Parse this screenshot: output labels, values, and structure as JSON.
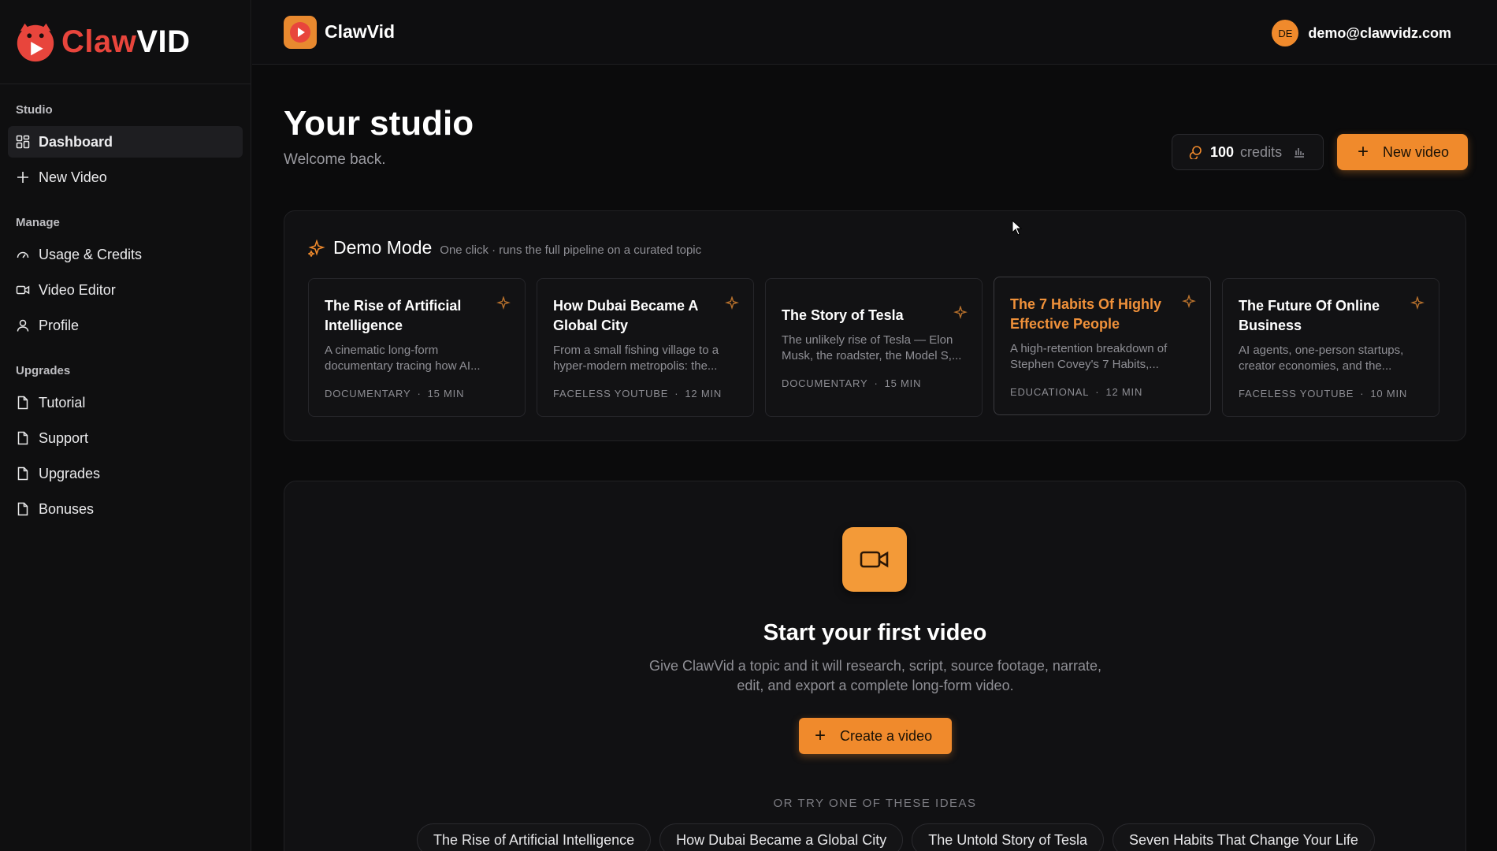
{
  "brand": {
    "part1": "Claw",
    "part2": "VID"
  },
  "sidebar": {
    "sections": [
      {
        "heading": "Studio",
        "items": [
          {
            "label": "Dashboard",
            "icon": "dashboard-icon",
            "active": true
          },
          {
            "label": "New Video",
            "icon": "plus-icon"
          }
        ]
      },
      {
        "heading": "Manage",
        "items": [
          {
            "label": "Usage & Credits",
            "icon": "gauge-icon"
          },
          {
            "label": "Video Editor",
            "icon": "video-icon"
          },
          {
            "label": "Profile",
            "icon": "user-icon"
          }
        ]
      },
      {
        "heading": "Upgrades",
        "items": [
          {
            "label": "Tutorial",
            "icon": "file-icon"
          },
          {
            "label": "Support",
            "icon": "file-icon"
          },
          {
            "label": "Upgrades",
            "icon": "file-icon"
          },
          {
            "label": "Bonuses",
            "icon": "file-icon"
          }
        ]
      }
    ]
  },
  "topbar": {
    "title": "ClawVid",
    "user_initials": "DE",
    "user_email": "demo@clawvidz.com"
  },
  "header": {
    "title": "Your studio",
    "subtitle": "Welcome back."
  },
  "credits": {
    "amount": "100",
    "label": "credits"
  },
  "actions": {
    "new_video": "New video",
    "create_video": "Create a video"
  },
  "demo": {
    "title": "Demo Mode",
    "description": "One click · runs the full pipeline on a curated topic",
    "cards": [
      {
        "title": "The Rise of Artificial Intelligence",
        "desc": "A cinematic long-form documentary tracing how AI...",
        "category": "DOCUMENTARY",
        "duration": "15 MIN"
      },
      {
        "title": "How Dubai Became A Global City",
        "desc": "From a small fishing village to a hyper-modern metropolis: the...",
        "category": "FACELESS YOUTUBE",
        "duration": "12 MIN"
      },
      {
        "title": "The Story of Tesla",
        "desc": "The unlikely rise of Tesla — Elon Musk, the roadster, the Model S,...",
        "category": "DOCUMENTARY",
        "duration": "15 MIN"
      },
      {
        "title": "The 7 Habits Of Highly Effective People",
        "desc": "A high-retention breakdown of Stephen Covey's 7 Habits,...",
        "category": "EDUCATIONAL",
        "duration": "12 MIN"
      },
      {
        "title": "The Future Of Online Business",
        "desc": "AI agents, one-person startups, creator economies, and the...",
        "category": "FACELESS YOUTUBE",
        "duration": "10 MIN"
      }
    ]
  },
  "empty": {
    "title": "Start your first video",
    "description": "Give ClawVid a topic and it will research, script, source footage, narrate, edit, and export a complete long-form video.",
    "ideas_label": "OR TRY ONE OF THESE IDEAS",
    "ideas": [
      "The Rise of Artificial Intelligence",
      "How Dubai Became a Global City",
      "The Untold Story of Tesla",
      "Seven Habits That Change Your Life"
    ]
  },
  "colors": {
    "accent": "#f08a2c",
    "brand_red": "#e8453c",
    "background": "#0b0b0c"
  }
}
